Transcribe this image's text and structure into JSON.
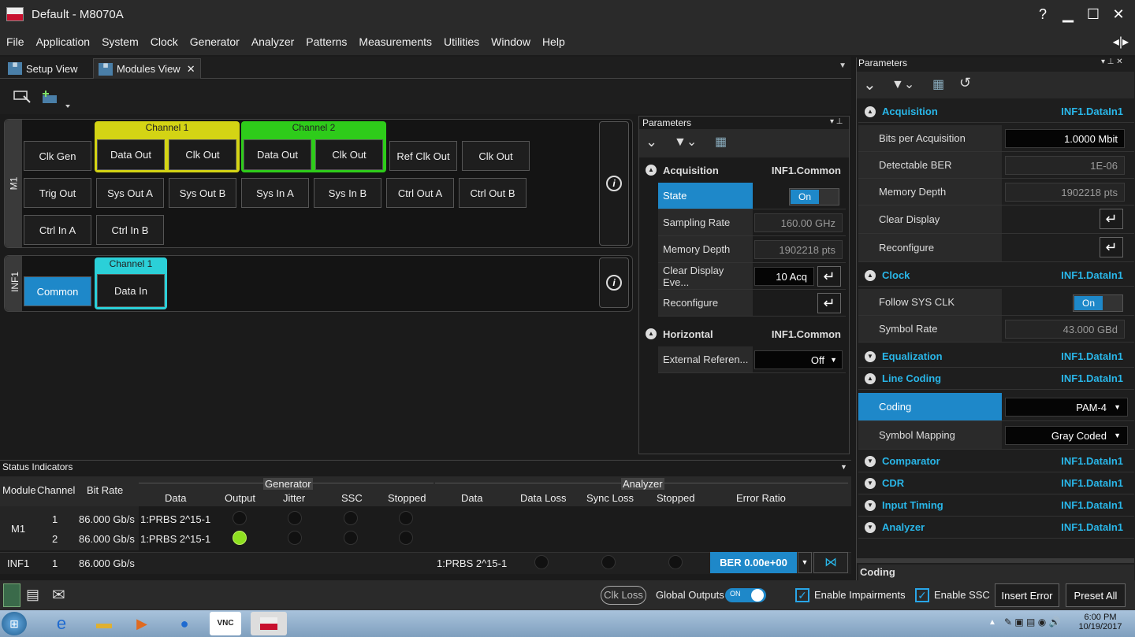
{
  "window": {
    "title": "Default - M8070A",
    "help": "?",
    "minimize": "▁",
    "maximize": "☐",
    "close": "✕"
  },
  "menu": [
    "File",
    "Application",
    "System",
    "Clock",
    "Generator",
    "Analyzer",
    "Patterns",
    "Measurements",
    "Utilities",
    "Window",
    "Help"
  ],
  "tabs": {
    "setup": "Setup View",
    "modules": "Modules View",
    "close": "✕"
  },
  "modules": {
    "m1": {
      "label": "M1",
      "channel1": "Channel 1",
      "channel2": "Channel 2",
      "buttons": [
        "Clk Gen",
        "Data Out",
        "Clk Out",
        "Data Out",
        "Clk Out",
        "Ref Clk Out",
        "Clk Out",
        "Trig Out",
        "Sys Out A",
        "Sys Out B",
        "Sys In A",
        "Sys In B",
        "Ctrl Out A",
        "Ctrl Out B",
        "Ctrl In A",
        "Ctrl In B"
      ]
    },
    "inf1": {
      "label": "INF1",
      "channel1": "Channel 1",
      "common": "Common",
      "data_in": "Data In"
    },
    "info": "i"
  },
  "params_mid": {
    "title": "Parameters",
    "acq_header": "Acquisition",
    "acq_module": "INF1.Common",
    "rows": {
      "state": "State",
      "state_val": "On",
      "sampling": "Sampling Rate",
      "sampling_val": "160.00 GHz",
      "memdepth": "Memory Depth",
      "memdepth_val": "1902218 pts",
      "clear": "Clear Display Eve...",
      "clear_val": "10 Acq",
      "reconf": "Reconfigure"
    },
    "horiz_header": "Horizontal",
    "horiz_module": "INF1.Common",
    "extref": "External Referen...",
    "extref_val": "Off"
  },
  "params_right": {
    "title": "Parameters",
    "acquisition": "Acquisition",
    "module": "INF1.DataIn1",
    "bits_per_acq": "Bits per Acquisition",
    "bits_per_acq_val": "1.0000 Mbit",
    "det_ber": "Detectable BER",
    "det_ber_val": "1E-06",
    "mem_depth": "Memory Depth",
    "mem_depth_val": "1902218 pts",
    "clear_display": "Clear Display",
    "reconfigure": "Reconfigure",
    "clock": "Clock",
    "follow_sys": "Follow SYS CLK",
    "follow_sys_val": "On",
    "symbol_rate": "Symbol Rate",
    "symbol_rate_val": "43.000 GBd",
    "equalization": "Equalization",
    "line_coding": "Line Coding",
    "coding": "Coding",
    "coding_val": "PAM-4",
    "symbol_mapping": "Symbol Mapping",
    "symbol_mapping_val": "Gray Coded",
    "comparator": "Comparator",
    "cdr": "CDR",
    "input_timing": "Input Timing",
    "analyzer": "Analyzer",
    "coding_footer": "Coding"
  },
  "status": {
    "title": "Status Indicators",
    "col_module": "Module",
    "col_channel": "Channel",
    "col_bitrate": "Bit Rate",
    "generator": "Generator",
    "analyzer": "Analyzer",
    "gen_cols": [
      "Data",
      "Output",
      "Jitter",
      "SSC",
      "Stopped"
    ],
    "ana_cols": [
      "Data",
      "Data Loss",
      "Sync Loss",
      "Stopped",
      "Error Ratio"
    ],
    "rows": [
      {
        "module": "M1",
        "channel": "1",
        "bitrate": "86.000 Gb/s",
        "data": "1:PRBS 2^15-1"
      },
      {
        "module": "",
        "channel": "2",
        "bitrate": "86.000 Gb/s",
        "data": "1:PRBS 2^15-1"
      },
      {
        "module": "INF1",
        "channel": "1",
        "bitrate": "86.000 Gb/s",
        "data": "1:PRBS 2^15-1"
      }
    ],
    "ber": "BER 0.00e+00"
  },
  "bottom": {
    "clk_loss": "Clk Loss",
    "global_outputs": "Global Outputs",
    "global_on": "ON",
    "enable_impairments": "Enable Impairments",
    "enable_ssc": "Enable SSC",
    "insert_error": "Insert Error",
    "preset_all": "Preset All"
  },
  "taskbar": {
    "time": "6:00 PM",
    "date": "10/19/2017"
  },
  "colors": {
    "accent": "#29b6e8",
    "selected": "#1e88c9",
    "ch1": "#d4d414",
    "ch2": "#2ecc1a",
    "inf_ch1": "#2bd0d8",
    "led_on": "#8ee020"
  }
}
